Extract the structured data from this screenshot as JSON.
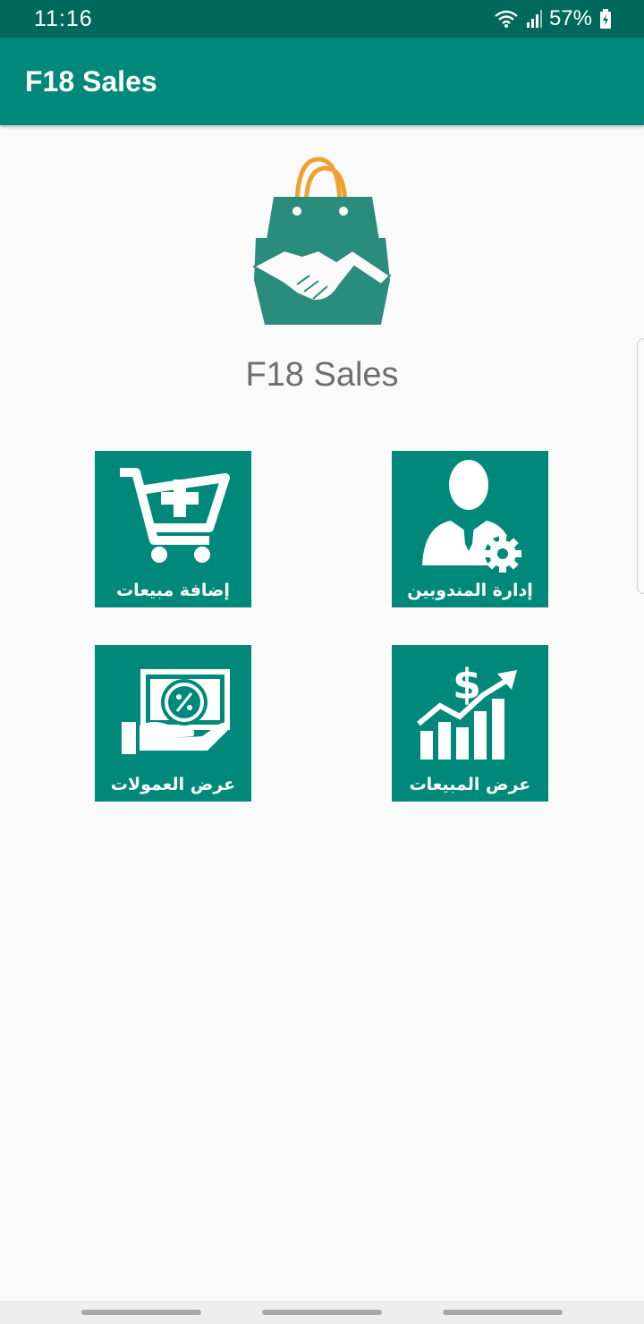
{
  "status_bar": {
    "time": "11:16",
    "battery": "57%"
  },
  "app_bar": {
    "title": "F18 Sales"
  },
  "main": {
    "app_name": "F18 Sales",
    "tiles": [
      {
        "label": "إضافة مبيعات",
        "icon": "cart-plus-icon"
      },
      {
        "label": "إدارة المندوبين",
        "icon": "manager-gear-icon"
      },
      {
        "label": "عرض العمولات",
        "icon": "hand-money-icon"
      },
      {
        "label": "عرض المبيعات",
        "icon": "sales-chart-icon"
      }
    ]
  },
  "colors": {
    "primary": "#00897b",
    "primary_dark": "#00695c",
    "accent": "#f0a030"
  }
}
